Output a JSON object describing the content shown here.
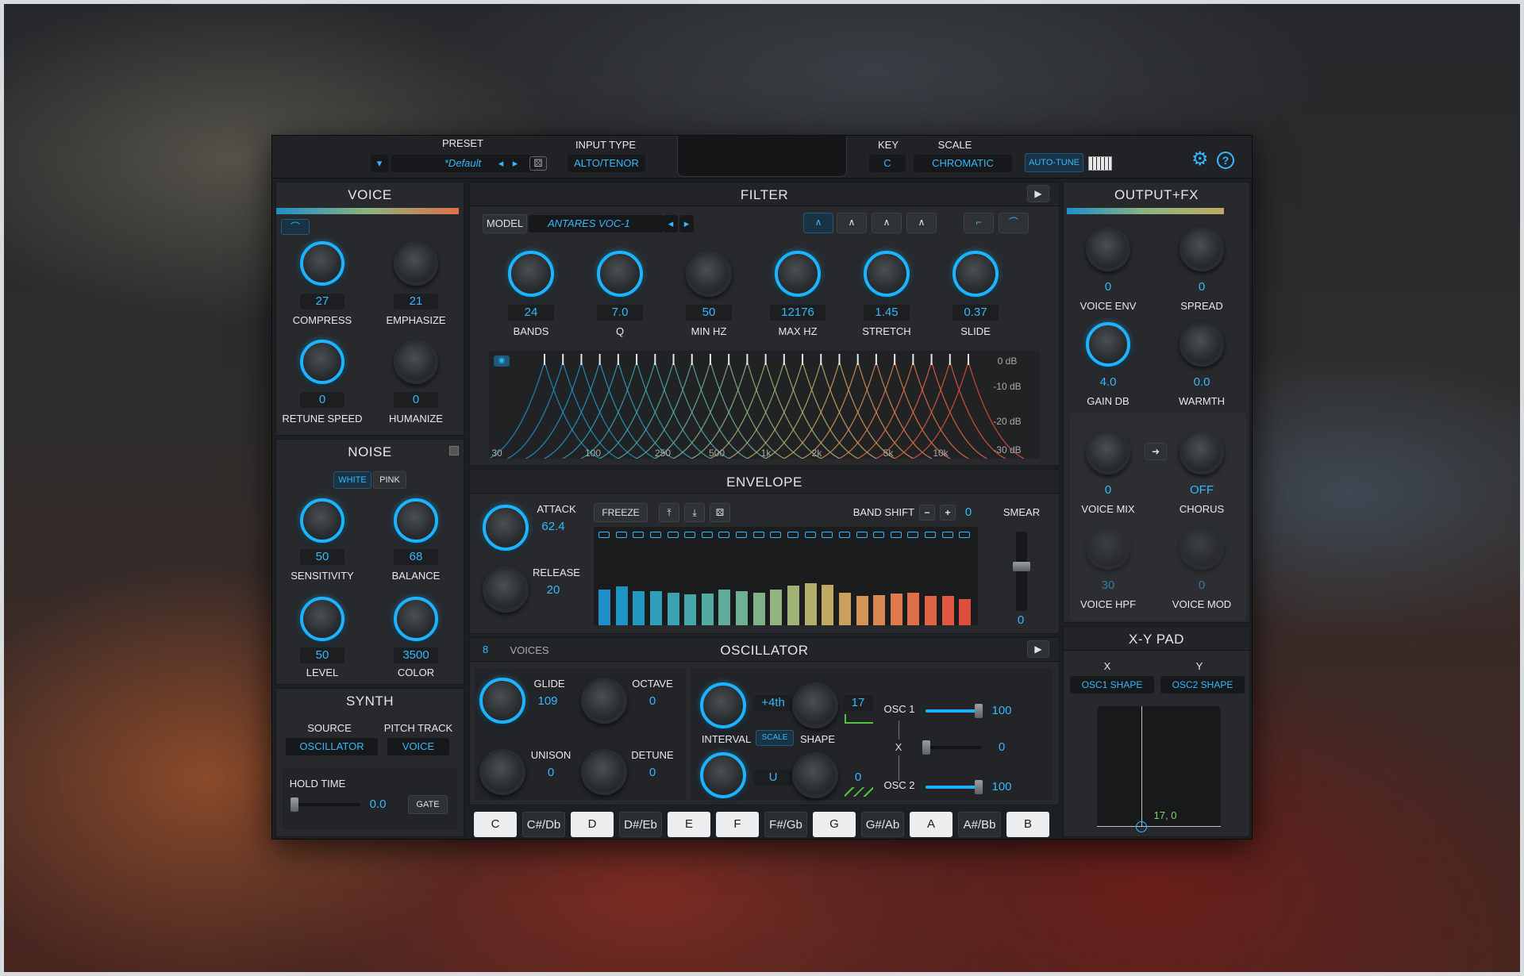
{
  "header": {
    "preset_label": "PRESET",
    "preset_value": "*Default",
    "input_type_label": "INPUT TYPE",
    "input_type_value": "ALTO/TENOR",
    "key_label": "KEY",
    "key_value": "C",
    "scale_label": "SCALE",
    "scale_value": "CHROMATIC",
    "autotune_label": "AUTO-TUNE"
  },
  "voice": {
    "title": "VOICE",
    "knobs": [
      {
        "label": "COMPRESS",
        "value": "27"
      },
      {
        "label": "EMPHASIZE",
        "value": "21"
      },
      {
        "label": "RETUNE SPEED",
        "value": "0"
      },
      {
        "label": "HUMANIZE",
        "value": "0"
      }
    ]
  },
  "noise": {
    "title": "NOISE",
    "white": "WHITE",
    "pink": "PINK",
    "knobs": [
      {
        "label": "SENSITIVITY",
        "value": "50"
      },
      {
        "label": "BALANCE",
        "value": "68"
      },
      {
        "label": "LEVEL",
        "value": "50"
      },
      {
        "label": "COLOR",
        "value": "3500"
      }
    ]
  },
  "synth": {
    "title": "SYNTH",
    "source_label": "SOURCE",
    "source_value": "OSCILLATOR",
    "pitch_label": "PITCH TRACK",
    "pitch_value": "VOICE",
    "hold_label": "HOLD TIME",
    "hold_value": "0.0",
    "gate": "GATE"
  },
  "filter": {
    "title": "FILTER",
    "model_label": "MODEL",
    "model_value": "ANTARES VOC-1",
    "knobs": [
      {
        "label": "BANDS",
        "value": "24"
      },
      {
        "label": "Q",
        "value": "7.0"
      },
      {
        "label": "MIN HZ",
        "value": "50"
      },
      {
        "label": "MAX HZ",
        "value": "12176"
      },
      {
        "label": "STRETCH",
        "value": "1.45"
      },
      {
        "label": "SLIDE",
        "value": "0.37"
      }
    ],
    "freq_ticks": [
      "30",
      "100",
      "250",
      "500",
      "1k",
      "2k",
      "5k",
      "10k"
    ],
    "db_ticks": [
      "0 dB",
      "-10 dB",
      "-20 dB",
      "-30 dB"
    ]
  },
  "envelope": {
    "title": "ENVELOPE",
    "attack_label": "ATTACK",
    "attack_value": "62.4",
    "release_label": "RELEASE",
    "release_value": "20",
    "freeze": "FREEZE",
    "band_shift_label": "BAND SHIFT",
    "band_shift_value": "0",
    "smear_label": "SMEAR",
    "smear_value": "0",
    "bands": [
      0.48,
      0.52,
      0.46,
      0.46,
      0.44,
      0.41,
      0.43,
      0.48,
      0.46,
      0.44,
      0.48,
      0.53,
      0.56,
      0.54,
      0.44,
      0.39,
      0.4,
      0.43,
      0.44,
      0.39,
      0.39,
      0.35
    ],
    "band_colors": [
      "#1e8fc8",
      "#1e94c6",
      "#2399c0",
      "#2f9fbb",
      "#3aa2b3",
      "#46a6ab",
      "#53aaa3",
      "#61ad9b",
      "#70b092",
      "#80b289",
      "#91b37f",
      "#a1b276",
      "#b2ae6c",
      "#c1a964",
      "#cba05c",
      "#d49456",
      "#d98851",
      "#dd7b4c",
      "#df6f48",
      "#e06344",
      "#e05840",
      "#df4e3d"
    ]
  },
  "oscillator": {
    "title": "OSCILLATOR",
    "voices_value": "8",
    "voices_label": "VOICES",
    "glide_label": "GLIDE",
    "glide_value": "109",
    "octave_label": "OCTAVE",
    "octave_value": "0",
    "unison_label": "UNISON",
    "unison_value": "0",
    "detune_label": "DETUNE",
    "detune_value": "0",
    "interval_value": "+4th",
    "interval_label": "INTERVAL",
    "scale_btn": "SCALE",
    "shape1_value": "17",
    "shape_label": "SHAPE",
    "interval2_value": "U",
    "shape2_value": "0",
    "osc1_label": "OSC 1",
    "osc1_value": "100",
    "x_label": "X",
    "x_value": "0",
    "osc2_label": "OSC 2",
    "osc2_value": "100"
  },
  "keys": [
    "C",
    "C#/Db",
    "D",
    "D#/Eb",
    "E",
    "F",
    "F#/Gb",
    "G",
    "G#/Ab",
    "A",
    "A#/Bb",
    "B"
  ],
  "outputfx": {
    "title": "OUTPUT+FX",
    "knobs": [
      {
        "label": "VOICE  ENV",
        "value": "0"
      },
      {
        "label": "SPREAD",
        "value": "0"
      },
      {
        "label": "GAIN DB",
        "value": "4.0"
      },
      {
        "label": "WARMTH",
        "value": "0.0"
      },
      {
        "label": "VOICE MIX",
        "value": "0"
      },
      {
        "label": "CHORUS",
        "value": "OFF"
      },
      {
        "label": "VOICE HPF",
        "value": "30"
      },
      {
        "label": "VOICE MOD",
        "value": "0"
      }
    ]
  },
  "xypad": {
    "title": "X-Y PAD",
    "x_label": "X",
    "y_label": "Y",
    "x_value": "OSC1 SHAPE",
    "y_value": "OSC2 SHAPE",
    "readout": "17, 0"
  },
  "colors": {
    "accent": "#1eb3ff",
    "panel": "#27292c",
    "background": "#1d2022"
  }
}
